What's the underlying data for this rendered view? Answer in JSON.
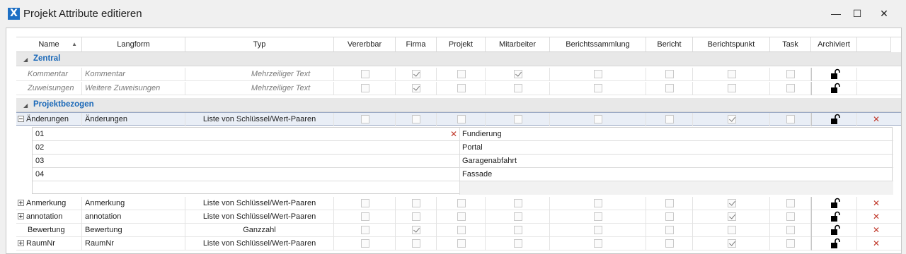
{
  "window": {
    "title": "Projekt Attribute editieren",
    "app_icon": "X",
    "minimize": "—",
    "maximize": "☐",
    "close": "✕"
  },
  "columns": [
    "Name",
    "Langform",
    "Typ",
    "Vererbbar",
    "Firma",
    "Projekt",
    "Mitarbeiter",
    "Berichtssammlung",
    "Bericht",
    "Berichtspunkt",
    "Task",
    "Archiviert"
  ],
  "groups": [
    {
      "label": "Zentral",
      "rows": [
        {
          "name": "Kommentar",
          "langform": "Kommentar",
          "typ": "Mehrzeiliger Text",
          "checks": [
            false,
            true,
            false,
            true,
            false,
            false,
            false,
            false
          ],
          "archived": "unlocked",
          "deletable": false,
          "expander": "",
          "italic": true
        },
        {
          "name": "Zuweisungen",
          "langform": "Weitere Zuweisungen",
          "typ": "Mehrzeiliger Text",
          "checks": [
            false,
            true,
            false,
            false,
            false,
            false,
            false,
            false
          ],
          "archived": "unlocked",
          "deletable": false,
          "expander": "",
          "italic": true
        }
      ]
    },
    {
      "label": "Projektbezogen",
      "rows": [
        {
          "name": "Änderungen",
          "langform": "Änderungen",
          "typ": "Liste von Schlüssel/Wert-Paaren",
          "checks": [
            false,
            false,
            false,
            false,
            false,
            false,
            true,
            false
          ],
          "archived": "unlocked",
          "deletable": true,
          "expander": "minus",
          "italic": false,
          "selected": true,
          "details": [
            {
              "key": "01",
              "value": "Fundierung"
            },
            {
              "key": "02",
              "value": "Portal"
            },
            {
              "key": "03",
              "value": "Garagenabfahrt"
            },
            {
              "key": "04",
              "value": "Fassade"
            }
          ]
        },
        {
          "name": "Anmerkung",
          "langform": "Anmerkung",
          "typ": "Liste von Schlüssel/Wert-Paaren",
          "checks": [
            false,
            false,
            false,
            false,
            false,
            false,
            true,
            false
          ],
          "archived": "unlocked",
          "deletable": true,
          "expander": "plus",
          "italic": false
        },
        {
          "name": "annotation",
          "langform": "annotation",
          "typ": "Liste von Schlüssel/Wert-Paaren",
          "checks": [
            false,
            false,
            false,
            false,
            false,
            false,
            true,
            false
          ],
          "archived": "unlocked",
          "deletable": true,
          "expander": "plus",
          "italic": false
        },
        {
          "name": "Bewertung",
          "langform": "Bewertung",
          "typ": "Ganzzahl",
          "checks": [
            false,
            true,
            false,
            false,
            false,
            false,
            false,
            false
          ],
          "archived": "unlocked",
          "deletable": true,
          "expander": "",
          "italic": false
        },
        {
          "name": "RaumNr",
          "langform": "RaumNr",
          "typ": "Liste von Schlüssel/Wert-Paaren",
          "checks": [
            false,
            false,
            false,
            false,
            false,
            false,
            true,
            false
          ],
          "archived": "unlocked",
          "deletable": true,
          "expander": "plus",
          "italic": false
        }
      ]
    }
  ],
  "delete_glyph": "✕",
  "colors": {
    "group_text": "#1a68b8",
    "delete": "#c0392b",
    "app_icon": "#1d6fc4"
  }
}
